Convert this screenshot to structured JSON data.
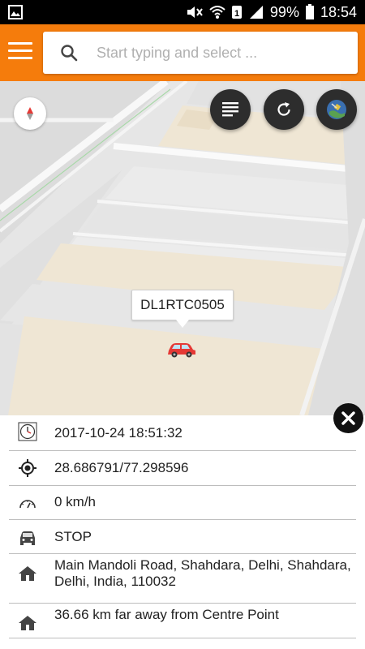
{
  "status_bar": {
    "battery_percent": "99%",
    "time": "18:54",
    "sim_label": "1"
  },
  "search": {
    "placeholder": "Start typing and select ..."
  },
  "map": {
    "vehicle_label": "DL1RTC0505",
    "car_color": "#e53935"
  },
  "details": {
    "datetime": "2017-10-24 18:51:32",
    "coordinates": "28.686791/77.298596",
    "speed": "0 km/h",
    "status": "STOP",
    "address": "Main Mandoli Road, Shahdara, Delhi, Shahdara, Delhi, India, 110032",
    "distance": "36.66 km far away from Centre Point"
  },
  "icons": {
    "menu": "hamburger-icon",
    "search": "search-icon",
    "compass": "compass-icon",
    "list": "list-icon",
    "refresh": "refresh-icon",
    "satellite": "satellite-icon",
    "close": "close-icon",
    "clock": "clock-icon",
    "location": "gps-icon",
    "speed": "speedometer-icon",
    "vehicle": "car-icon",
    "address": "home-icon",
    "distance": "home-icon"
  },
  "colors": {
    "appbar": "#f57c0c",
    "status_bar": "#000000",
    "fab": "#2d2d2d"
  }
}
